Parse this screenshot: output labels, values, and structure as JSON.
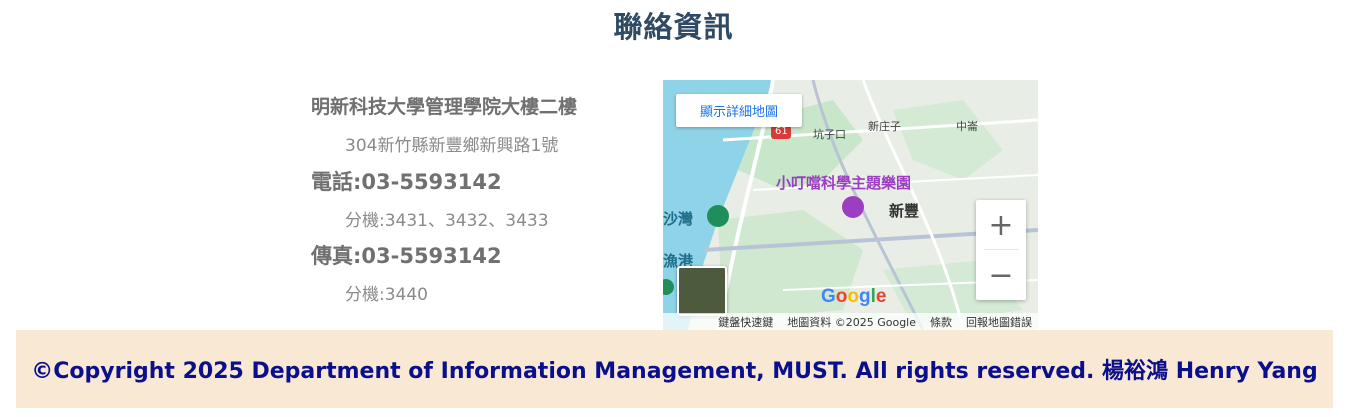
{
  "title": "聯絡資訊",
  "contact": {
    "place": "明新科技大學管理學院大樓二樓",
    "address": "304新竹縣新豐鄉新興路1號",
    "phone": "電話:03-5593142",
    "phone_ext": "分機:3431、3432、3433",
    "fax": "傳真:03-5593142",
    "fax_ext": "分機:3440"
  },
  "map": {
    "view_larger_label": "顯示詳細地圖",
    "zoom_in": "+",
    "zoom_out": "−",
    "labels": {
      "kengzikou": "坑子口",
      "xinzhuangzi": "新庄子",
      "zhongken": "中崙",
      "poi": "小叮噹科學主題樂園",
      "xinfeng": "新豐",
      "shawan": "沙灣",
      "yugang": "漁港",
      "route": "61"
    },
    "google_logo": "Google",
    "keyboard_shortcuts": "鍵盤快速鍵",
    "map_data": "地圖資料 ©2025 Google",
    "terms": "條款",
    "report": "回報地圖錯誤",
    "colors": {
      "water": "#8fd3e8",
      "land": "#e8eee5",
      "green": "#c8e6c9",
      "road": "#ffffff",
      "poi": "#9c3ec1"
    }
  },
  "footer": {
    "text": "©Copyright 2025 Department of Information Management, MUST. All rights reserved. 楊裕鴻 Henry Yang"
  }
}
